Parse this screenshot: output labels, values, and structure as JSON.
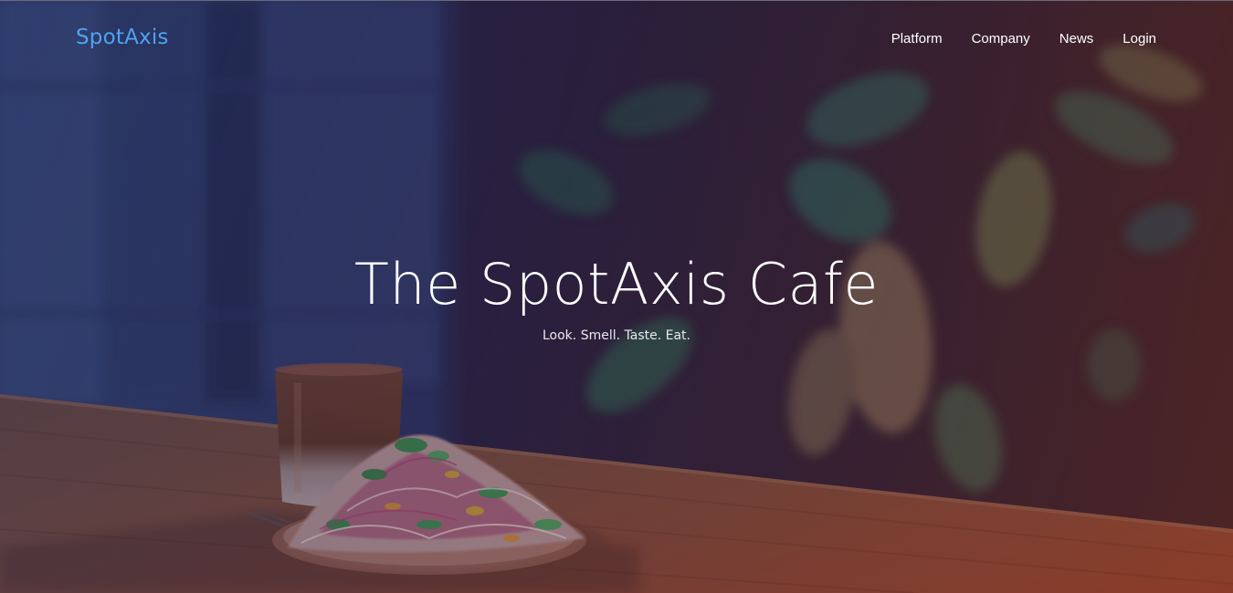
{
  "brand": {
    "logo_text": "SpotAxis",
    "logo_color": "#4fa3f0"
  },
  "nav": {
    "items": [
      {
        "label": "Platform"
      },
      {
        "label": "Company"
      },
      {
        "label": "News"
      },
      {
        "label": "Login"
      }
    ]
  },
  "hero": {
    "title": "The SpotAxis Cafe",
    "subtitle": "Look. Smell. Taste. Eat.",
    "background_image": "photo-cafe-table-salad-drink-plant"
  },
  "colors": {
    "text": "#ffffff",
    "accent": "#4fa3f0"
  }
}
